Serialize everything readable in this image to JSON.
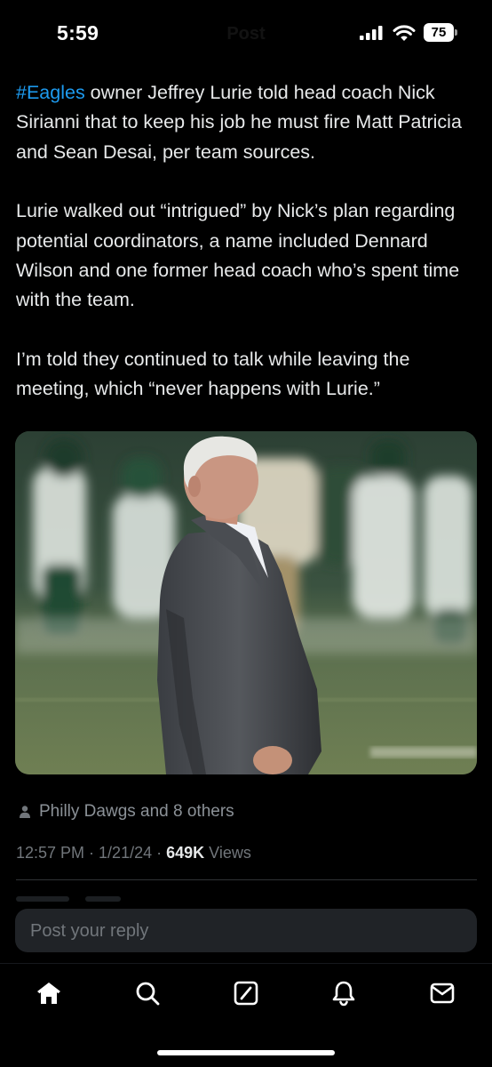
{
  "status_bar": {
    "time": "5:59",
    "header_title": "Post",
    "battery": "75"
  },
  "tweet": {
    "hashtag": "#Eagles",
    "paragraph_1_rest": " owner Jeffrey Lurie told head coach Nick Sirianni that to keep his job he must fire Matt Patricia and Sean Desai, per team sources.",
    "paragraph_2": "Lurie walked out “intrigued” by Nick’s plan regarding potential coordinators, a name included Dennard Wilson and one former head coach who’s spent time with the team.",
    "paragraph_3": "I’m told they continued to talk while leaving the meeting, which “never happens with Lurie.”"
  },
  "social_context": {
    "text": "Philly Dawgs and 8 others",
    "icon": "person-icon"
  },
  "meta": {
    "time": "12:57 PM",
    "sep1": " · ",
    "date": "1/21/24",
    "sep2": " · ",
    "views_count": "649K",
    "views_label": " Views"
  },
  "reply": {
    "placeholder": "Post your reply"
  },
  "tab_bar": {
    "items": [
      "home-icon",
      "search-icon",
      "compose-icon",
      "notifications-icon",
      "messages-icon"
    ],
    "active": "home-icon"
  },
  "colors": {
    "background": "#000000",
    "text": "#e7e9ea",
    "secondary_text": "#71767b",
    "link": "#1d9bf0",
    "reply_bar": "#202327"
  }
}
